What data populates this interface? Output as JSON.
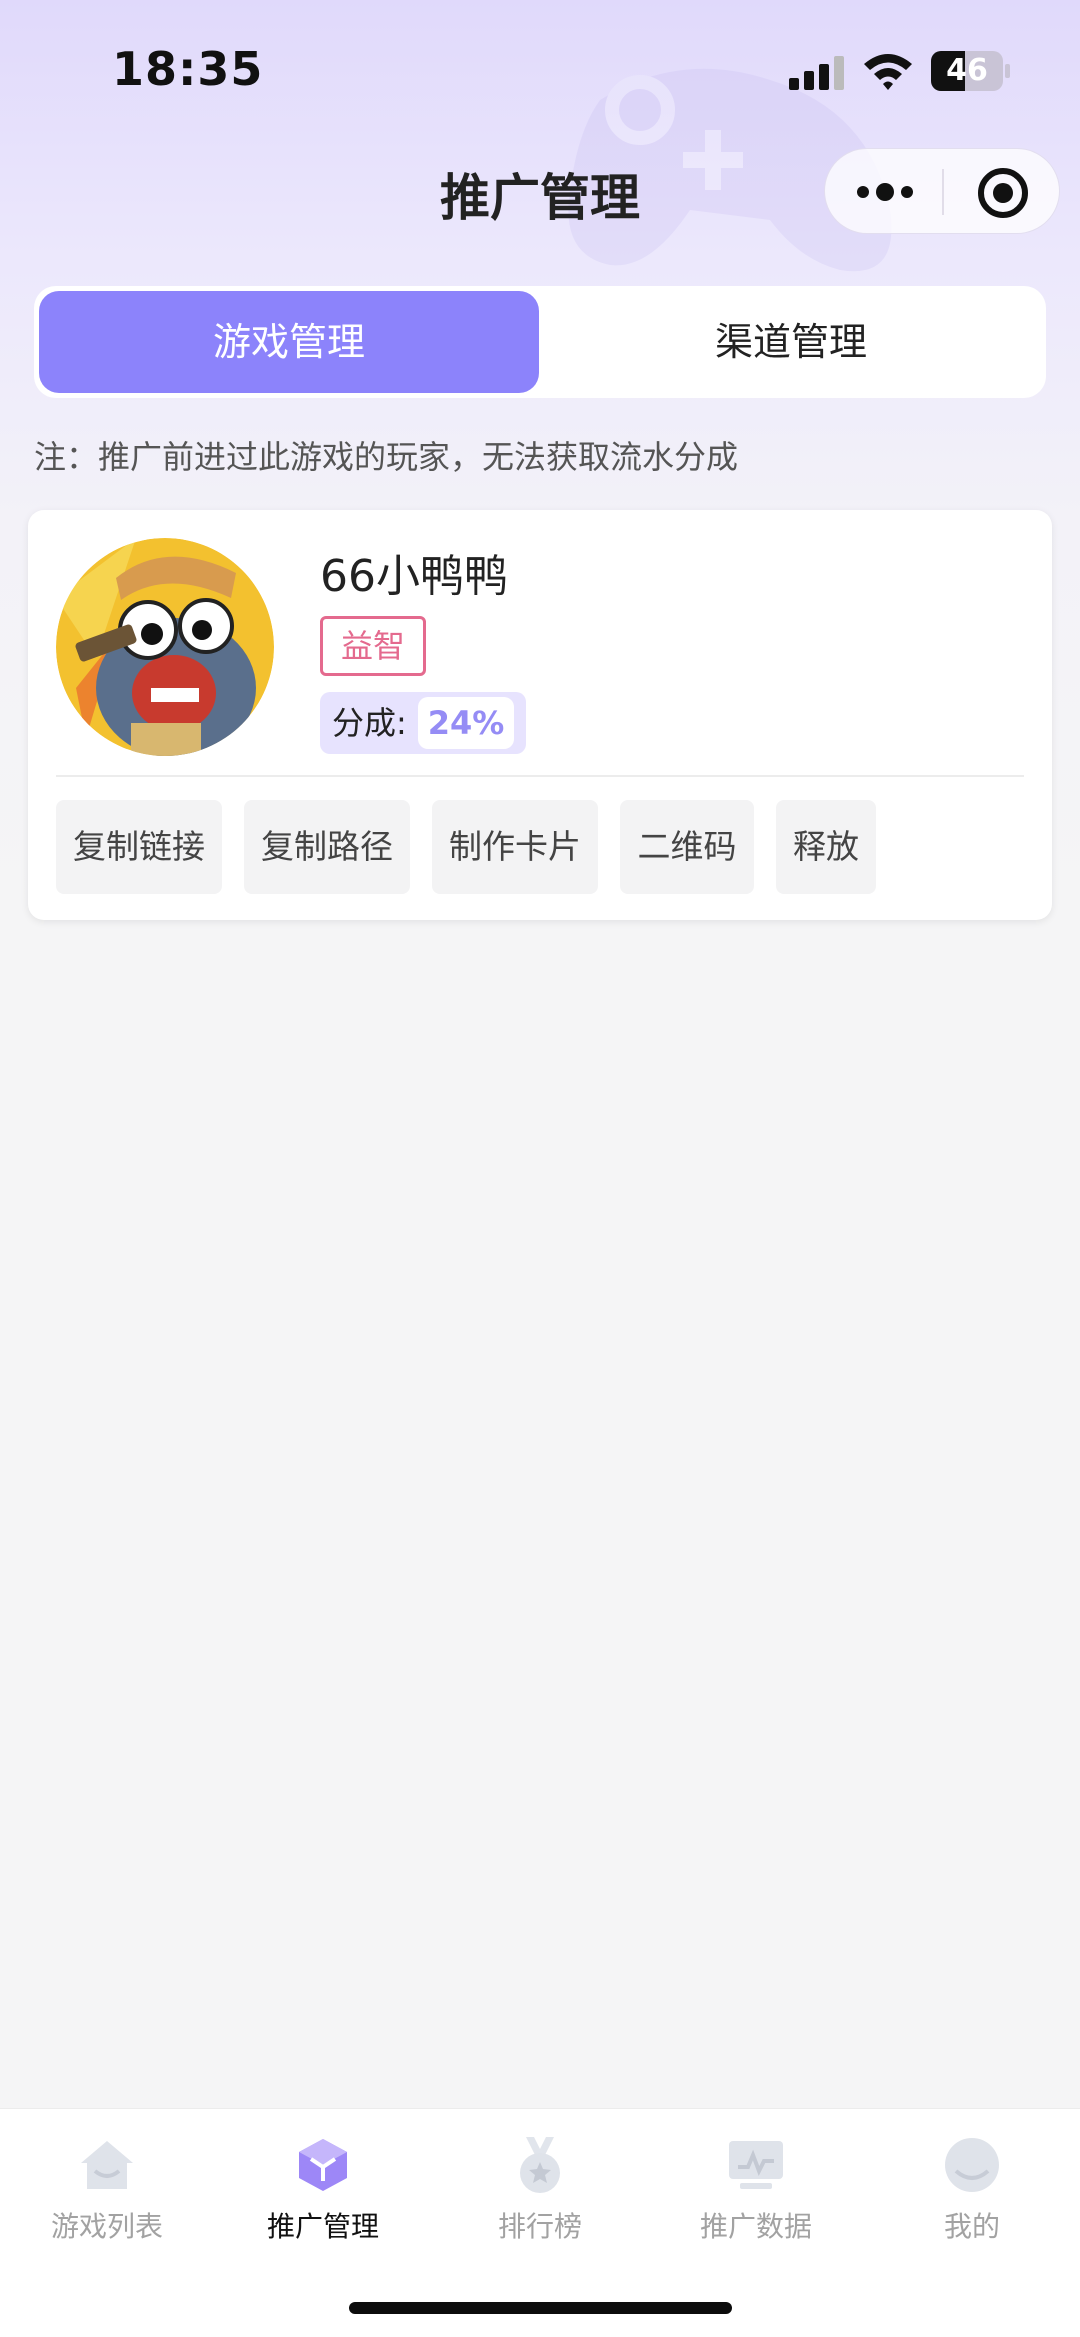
{
  "status_bar": {
    "time": "18:35",
    "battery": "46"
  },
  "nav": {
    "title": "推广管理"
  },
  "tabs": [
    {
      "label": "游戏管理",
      "active": true
    },
    {
      "label": "渠道管理",
      "active": false
    }
  ],
  "notice": "注：推广前进过此游戏的玩家，无法获取流水分成",
  "game_card": {
    "name": "66小鸭鸭",
    "tag": "益智",
    "share_label": "分成:",
    "share_value": "24%",
    "actions": [
      "复制链接",
      "复制路径",
      "制作卡片",
      "二维码",
      "释放"
    ]
  },
  "tabbar": [
    {
      "label": "游戏列表",
      "icon": "home-icon",
      "active": false
    },
    {
      "label": "推广管理",
      "icon": "cube-icon",
      "active": true
    },
    {
      "label": "排行榜",
      "icon": "medal-icon",
      "active": false
    },
    {
      "label": "推广数据",
      "icon": "chart-monitor-icon",
      "active": false
    },
    {
      "label": "我的",
      "icon": "profile-icon",
      "active": false
    }
  ],
  "colors": {
    "accent": "#8c83fb",
    "tag": "#e46a8e",
    "share_value": "#958cf5",
    "background": "#f5f5f6"
  }
}
